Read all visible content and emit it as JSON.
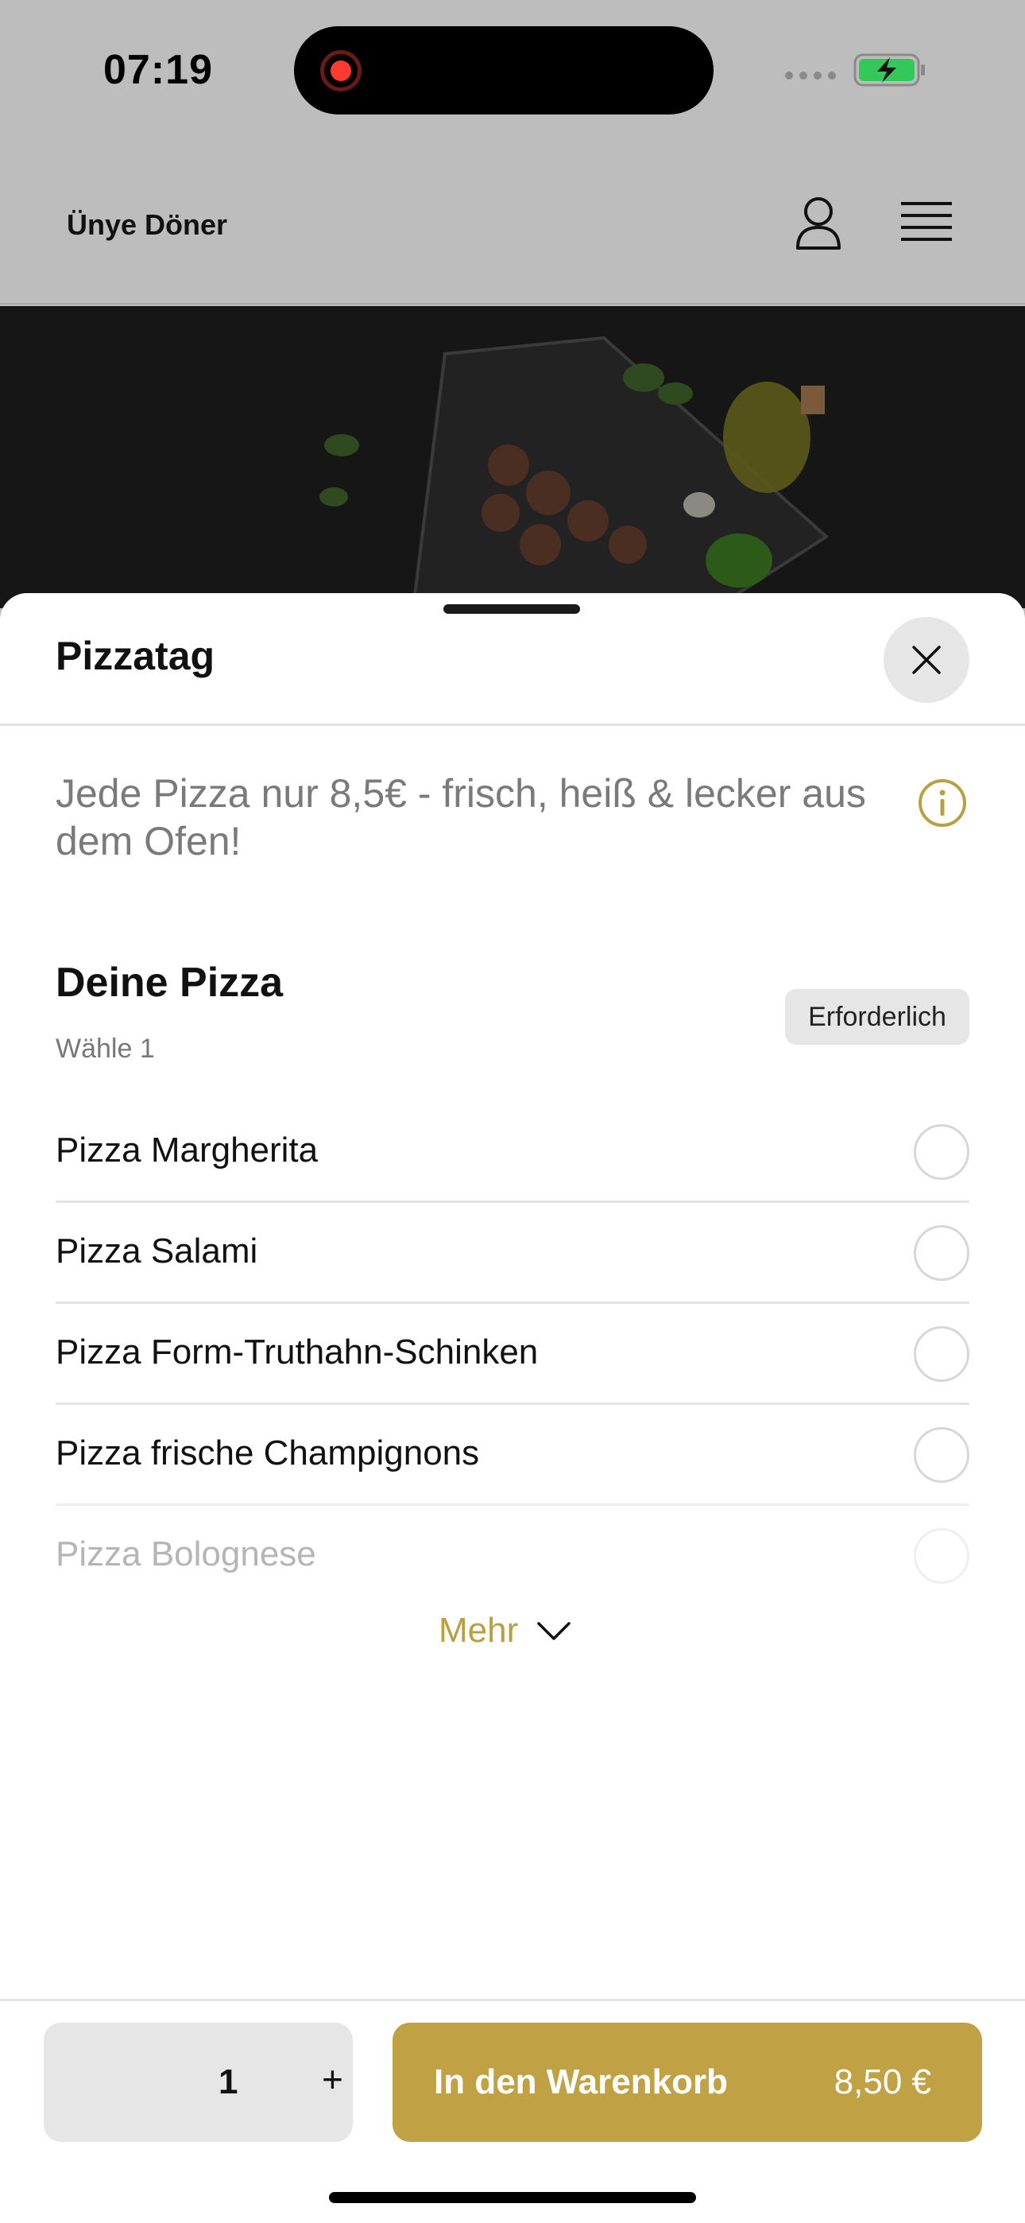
{
  "status_bar": {
    "time": "07:19"
  },
  "header": {
    "app_name": "Ünye Döner"
  },
  "sheet": {
    "title": "Pizzatag",
    "description": "Jede Pizza nur 8,5€ - frisch, heiß & lecker aus dem Ofen!",
    "group": {
      "title": "Deine Pizza",
      "subtitle": "Wähle 1",
      "badge": "Erforderlich",
      "options": [
        {
          "label": "Pizza Margherita"
        },
        {
          "label": "Pizza Salami"
        },
        {
          "label": "Pizza Form-Truthahn-Schinken"
        },
        {
          "label": "Pizza frische Champignons"
        },
        {
          "label": "Pizza Bolognese"
        }
      ],
      "more_label": "Mehr"
    }
  },
  "footer": {
    "quantity": "1",
    "plus_label": "+",
    "cart_label": "In den Warenkorb",
    "price": "8,50 €"
  },
  "colors": {
    "accent": "#c0a244",
    "accent_text": "#b8a040",
    "overlay": "#bdbdbd",
    "battery": "#34c759"
  },
  "icons": [
    "record-icon",
    "battery-icon",
    "user-icon",
    "menu-icon",
    "close-icon",
    "info-icon",
    "chevron-down-icon"
  ]
}
